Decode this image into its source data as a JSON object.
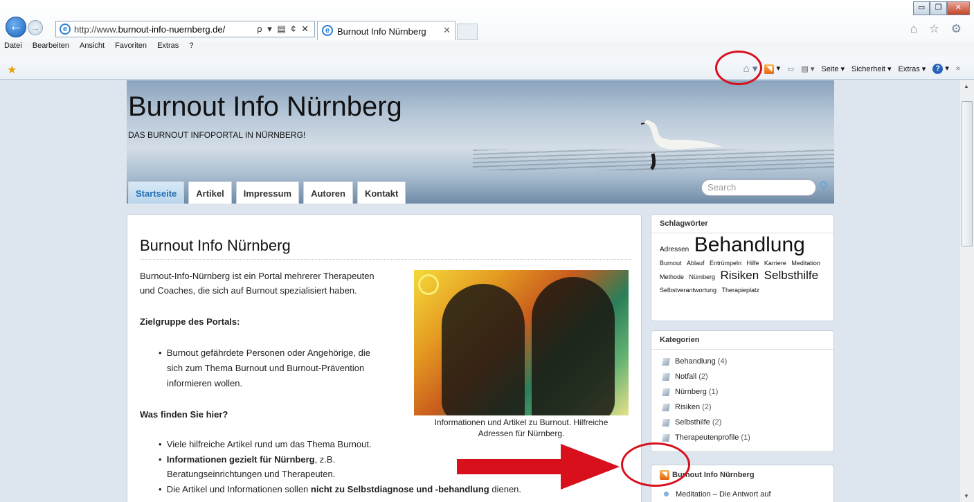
{
  "browser": {
    "url_prefix": "http://www.",
    "url_domain": "burnout-info-nuernberg.de/",
    "address_controls": "ρ ▾ ▤ ¢ ✕",
    "tab_title": "Burnout Info Nürnberg",
    "tab_close": "✕",
    "window_buttons": [
      "▭",
      "❐",
      "✕"
    ],
    "right_icons": "⌂ ☆ ⚙",
    "menu": [
      "Datei",
      "Bearbeiten",
      "Ansicht",
      "Favoriten",
      "Extras",
      "?"
    ],
    "commands": [
      "Seite ▾",
      "Sicherheit ▾",
      "Extras ▾"
    ],
    "overflow": "»"
  },
  "site": {
    "title": "Burnout Info Nürnberg",
    "subtitle": "DAS BURNOUT INFOPORTAL IN NÜRNBERG!",
    "nav": [
      "Startseite",
      "Artikel",
      "Impressum",
      "Autoren",
      "Kontakt"
    ],
    "search_placeholder": "Search"
  },
  "article": {
    "heading": "Burnout Info Nürnberg",
    "intro_line1": "Burnout-Info-Nürnberg ist ein Portal mehrerer Therapeuten",
    "intro_line2": "und Coaches, die sich auf Burnout spezialisiert haben.",
    "section1": "Zielgruppe des Portals:",
    "bullet1_line1": "Burnout gefährdete Personen oder Angehörige, die",
    "bullet1_line2": "sich zum Thema Burnout und Burnout-Prävention",
    "bullet1_line3": "informieren wollen.",
    "section2": "Was finden Sie hier?",
    "bullet2": "Viele hilfreiche Artikel rund um das Thema Burnout.",
    "bullet3_bold": "Informationen gezielt für Nürnberg",
    "bullet3_rest": ", z.B.",
    "bullet3_line2": "Beratungseinrichtungen und Therapeuten.",
    "bullet4_pre": "Die Artikel und Informationen sollen ",
    "bullet4_bold": "nicht zu Selbstdiagnose und -behandlung",
    "bullet4_post": " dienen.",
    "caption_line1": "Informationen und Artikel zu Burnout. Hilfreiche",
    "caption_line2": "Adressen für Nürnberg."
  },
  "sidebar": {
    "tags_title": "Schlagwörter",
    "tags": [
      {
        "text": "Adressen",
        "size": 10
      },
      {
        "text": "Behandlung",
        "size": 30
      },
      {
        "text": "Burnout",
        "size": 9
      },
      {
        "text": "Ablauf",
        "size": 9
      },
      {
        "text": "Entrümpeln",
        "size": 9
      },
      {
        "text": "Hilfe",
        "size": 9
      },
      {
        "text": "Karriere",
        "size": 9
      },
      {
        "text": "Meditation",
        "size": 9
      },
      {
        "text": "Methode",
        "size": 9
      },
      {
        "text": "Nürnberg",
        "size": 9
      },
      {
        "text": "Risiken",
        "size": 17
      },
      {
        "text": "Selbsthilfe",
        "size": 17
      },
      {
        "text": "Selbstverantwortung",
        "size": 9
      },
      {
        "text": "Therapieplatz",
        "size": 9
      }
    ],
    "categories_title": "Kategorien",
    "categories": [
      {
        "name": "Behandlung",
        "count": "(4)"
      },
      {
        "name": "Notfall",
        "count": "(2)"
      },
      {
        "name": "Nürnberg",
        "count": "(1)"
      },
      {
        "name": "Risiken",
        "count": "(2)"
      },
      {
        "name": "Selbsthilfe",
        "count": "(2)"
      },
      {
        "name": "Therapeutenprofile",
        "count": "(1)"
      }
    ],
    "feed_title": "Burnout Info Nürnberg",
    "feed_item": "Meditation – Die Antwort auf"
  },
  "colors": {
    "annotation_red": "#d8101c",
    "accent_blue": "#246fb5"
  }
}
